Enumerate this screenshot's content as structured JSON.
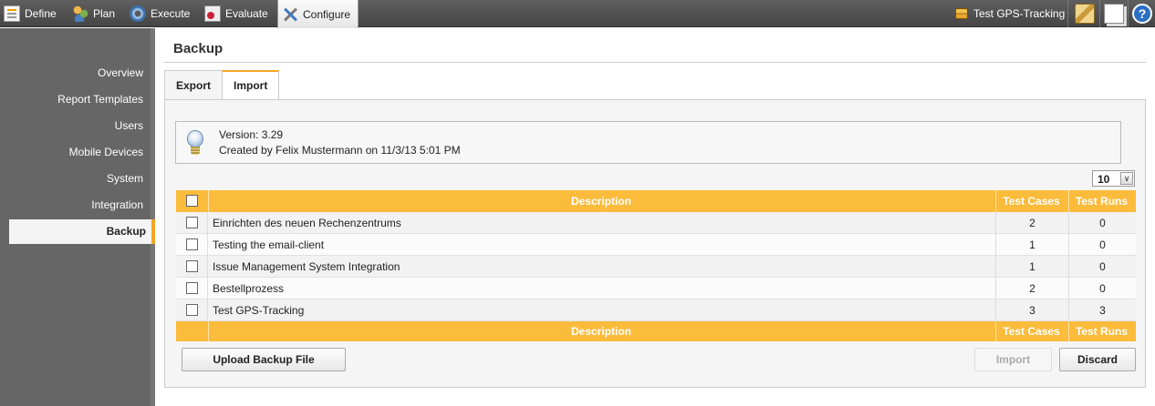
{
  "nav": {
    "items": [
      {
        "label": "Define",
        "icon": "define-icon"
      },
      {
        "label": "Plan",
        "icon": "plan-icon"
      },
      {
        "label": "Execute",
        "icon": "execute-icon"
      },
      {
        "label": "Evaluate",
        "icon": "evaluate-icon"
      },
      {
        "label": "Configure",
        "icon": "configure-icon",
        "active": true
      }
    ],
    "project": "Test GPS-Tracking",
    "tools": [
      "tools-icon",
      "pages-icon",
      "help-icon"
    ],
    "help_glyph": "?"
  },
  "sidebar": {
    "items": [
      {
        "label": "Overview"
      },
      {
        "label": "Report Templates"
      },
      {
        "label": "Users"
      },
      {
        "label": "Mobile Devices"
      },
      {
        "label": "System"
      },
      {
        "label": "Integration"
      },
      {
        "label": "Backup",
        "active": true
      }
    ]
  },
  "page": {
    "title": "Backup",
    "tabs": [
      {
        "label": "Export"
      },
      {
        "label": "Import",
        "active": true
      }
    ]
  },
  "info": {
    "version": "Version: 3.29",
    "created": "Created by Felix Mustermann on 11/3/13 5:01 PM"
  },
  "pager": {
    "page_size": "10",
    "dropdown_glyph": "∨"
  },
  "table": {
    "columns": {
      "description": "Description",
      "test_cases": "Test Cases",
      "test_runs": "Test Runs"
    },
    "rows": [
      {
        "description": "Einrichten des neuen Rechenzentrums",
        "test_cases": "2",
        "test_runs": "0"
      },
      {
        "description": "Testing the email-client",
        "test_cases": "1",
        "test_runs": "0"
      },
      {
        "description": "Issue Management System Integration",
        "test_cases": "1",
        "test_runs": "0"
      },
      {
        "description": "Bestellprozess",
        "test_cases": "2",
        "test_runs": "0"
      },
      {
        "description": "Test GPS-Tracking",
        "test_cases": "3",
        "test_runs": "3"
      }
    ]
  },
  "buttons": {
    "upload": "Upload Backup File",
    "import": "Import",
    "discard": "Discard"
  },
  "colors": {
    "accent": "#fbbb3b",
    "sidebar": "#666666",
    "topbar": "#4f4f4f"
  }
}
